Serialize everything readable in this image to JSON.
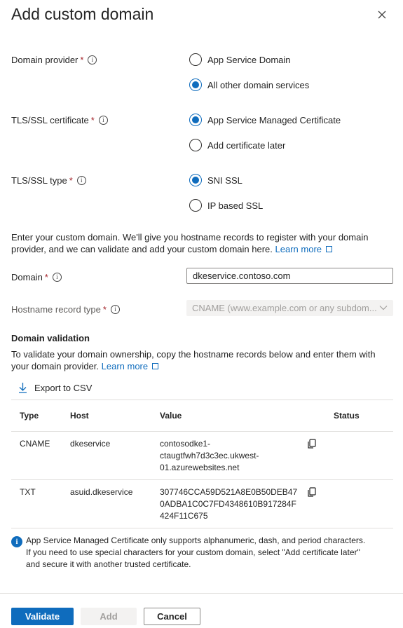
{
  "panel": {
    "title": "Add custom domain"
  },
  "domain_provider": {
    "label": "Domain provider",
    "required": "*",
    "options": [
      "App Service Domain",
      "All other domain services"
    ],
    "selected": "All other domain services"
  },
  "tls_certificate": {
    "label": "TLS/SSL certificate",
    "required": "*",
    "options": [
      "App Service Managed Certificate",
      "Add certificate later"
    ],
    "selected": "App Service Managed Certificate"
  },
  "tls_type": {
    "label": "TLS/SSL type",
    "required": "*",
    "options": [
      "SNI SSL",
      "IP based SSL"
    ],
    "selected": "SNI SSL"
  },
  "intro": {
    "text": "Enter your custom domain. We'll give you hostname records to register with your domain provider, and we can validate and add your custom domain here.",
    "link": "Learn more"
  },
  "domain": {
    "label": "Domain",
    "required": "*",
    "value": "dkeservice.contoso.com"
  },
  "hostname_record_type": {
    "label": "Hostname record type",
    "required": "*",
    "value": "CNAME (www.example.com or any subdom..."
  },
  "validation": {
    "heading": "Domain validation",
    "text": "To validate your domain ownership, copy the hostname records below and enter them with your domain provider.",
    "link": "Learn more",
    "export_label": "Export to CSV",
    "columns": [
      "Type",
      "Host",
      "Value",
      "Status"
    ],
    "rows": [
      {
        "type": "CNAME",
        "host": "dkeservice",
        "value": "contosodke1-ctaugtfwh7d3c3ec.ukwest-01.azurewebsites.net",
        "value_lines": [
          "contosodke1-",
          "ctaugtfwh7d3c3ec.ukwest-",
          "01.azurewebsites.net"
        ],
        "status": ""
      },
      {
        "type": "TXT",
        "host": "asuid.dkeservice",
        "value": "307746CCA59D521A8E0B50DEB470ADBA1C0C7FD4348610B917284F424F11C675",
        "value_lines": [
          "307746CCA59D521A8E0B50DEB47",
          "0ADBA1C0C7FD4348610B917284F",
          "424F11C675"
        ],
        "status": ""
      }
    ]
  },
  "note": {
    "lines": [
      "App Service Managed Certificate only supports alphanumeric, dash, and period characters.",
      "If you need to use special characters for your custom domain, select \"Add certificate later\"",
      "and secure it with another trusted certificate."
    ]
  },
  "footer": {
    "validate": "Validate",
    "add": "Add",
    "cancel": "Cancel"
  },
  "colors": {
    "accent": "#0f6cbd",
    "required": "#a4262c",
    "border": "#e1dfdd"
  },
  "icons": [
    "close-icon",
    "info-icon",
    "external-link-icon",
    "download-icon",
    "copy-icon",
    "chevron-down-icon"
  ]
}
